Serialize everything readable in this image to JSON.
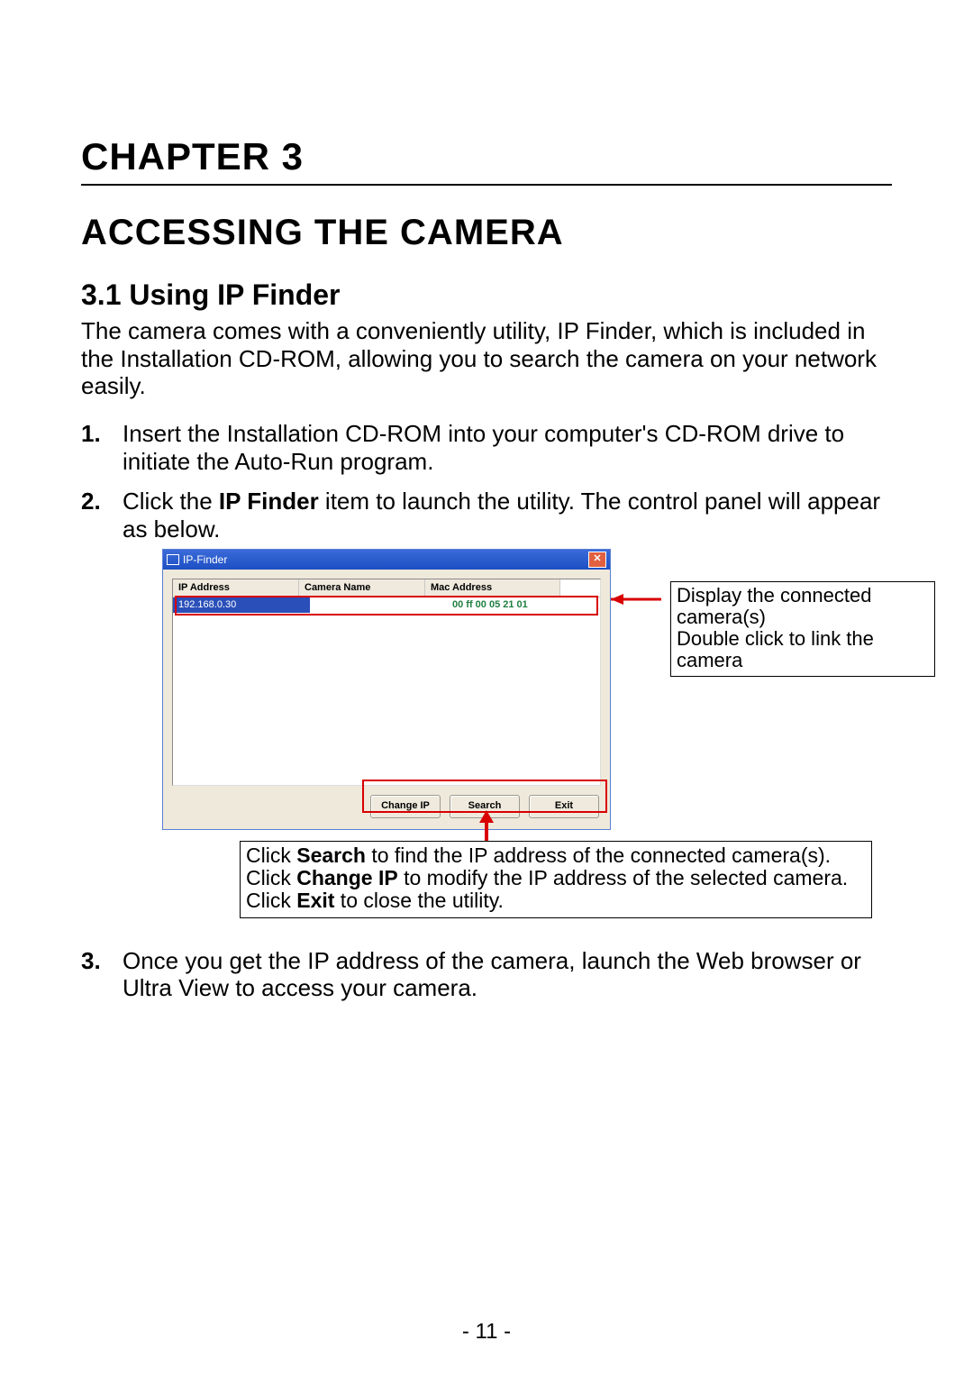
{
  "chapter_label": "CHAPTER 3",
  "chapter_title": "ACCESSING THE CAMERA",
  "section_heading": "3.1  Using IP Finder",
  "intro_paragraph": "The camera comes with a conveniently utility, IP Finder, which is included in the Installation CD-ROM, allowing you to search the camera on your network easily.",
  "steps": {
    "s1": "Insert the Installation CD-ROM into your computer's CD-ROM drive to initiate the Auto-Run program.",
    "s2_pre": "Click the ",
    "s2_bold": "IP Finder",
    "s2_post": " item to launch the utility. The control panel will appear as below.",
    "s3": "Once you get the IP address of the camera, launch the Web browser or Ultra View to access your camera."
  },
  "ipfinder": {
    "window_title": "IP-Finder",
    "close_glyph": "✕",
    "columns": {
      "ip": "IP Address",
      "name": "Camera Name",
      "mac": "Mac Address"
    },
    "row1": {
      "ip": "192.168.0.30",
      "name": "",
      "mac": "00 ff 00 05 21 01"
    },
    "buttons": {
      "change_ip": "Change IP",
      "search": "Search",
      "exit": "Exit"
    }
  },
  "callouts": {
    "right_line1": "Display the connected camera(s)",
    "right_line2": "Double click to link the camera",
    "bottom": {
      "l1a": "Click ",
      "l1b": "Search",
      "l1c": " to find the IP address of the connected camera(s).",
      "l2a": "Click ",
      "l2b": "Change IP",
      "l2c": " to modify the IP address of the selected camera.",
      "l3a": "Click ",
      "l3b": "Exit",
      "l3c": " to close the utility."
    }
  },
  "page_number": "- 11 -"
}
